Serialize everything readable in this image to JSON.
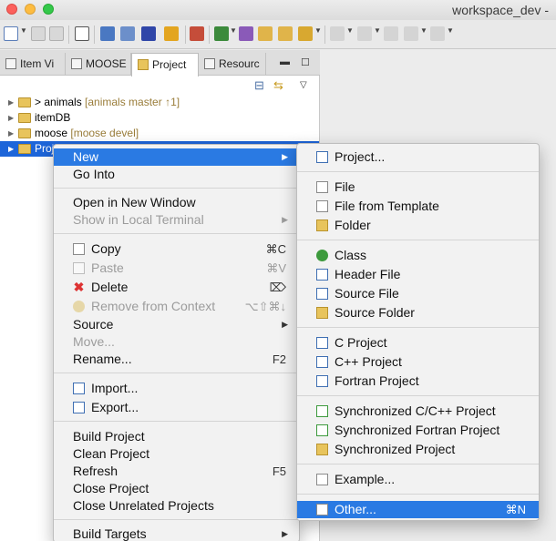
{
  "window": {
    "title": "workspace_dev -"
  },
  "tabs": [
    {
      "label": "Item Vi"
    },
    {
      "label": "MOOSE"
    },
    {
      "label": "Project"
    },
    {
      "label": "Resourc"
    }
  ],
  "tree": [
    {
      "prefix": "> ",
      "name": "animals",
      "decoration": " [animals master ↑1]"
    },
    {
      "prefix": "",
      "name": "itemDB",
      "decoration": ""
    },
    {
      "prefix": "",
      "name": "moose",
      "decoration": " [moose devel]"
    },
    {
      "prefix": "",
      "name": "Proj",
      "decoration": ""
    }
  ],
  "context_menu": {
    "new": "New",
    "go_into": "Go Into",
    "open_new_window": "Open in New Window",
    "show_terminal": "Show in Local Terminal",
    "copy": "Copy",
    "copy_sc": "⌘C",
    "paste": "Paste",
    "paste_sc": "⌘V",
    "delete": "Delete",
    "delete_sc": "⌦",
    "remove_context": "Remove from Context",
    "remove_context_sc": "⌥⇧⌘↓",
    "source": "Source",
    "move": "Move...",
    "rename": "Rename...",
    "rename_sc": "F2",
    "import": "Import...",
    "export": "Export...",
    "build_project": "Build Project",
    "clean_project": "Clean Project",
    "refresh": "Refresh",
    "refresh_sc": "F5",
    "close_project": "Close Project",
    "close_unrelated": "Close Unrelated Projects",
    "build_targets": "Build Targets"
  },
  "submenu": {
    "project": "Project...",
    "file": "File",
    "file_template": "File from Template",
    "folder": "Folder",
    "class": "Class",
    "header_file": "Header File",
    "source_file": "Source File",
    "source_folder": "Source Folder",
    "c_project": "C Project",
    "cpp_project": "C++ Project",
    "fortran_project": "Fortran Project",
    "sync_c_cpp": "Synchronized C/C++ Project",
    "sync_fortran": "Synchronized Fortran Project",
    "sync_project": "Synchronized Project",
    "example": "Example...",
    "other": "Other...",
    "other_sc": "⌘N"
  },
  "colors": {
    "highlight": "#2a7ae3",
    "selection": "#1d65d9"
  }
}
